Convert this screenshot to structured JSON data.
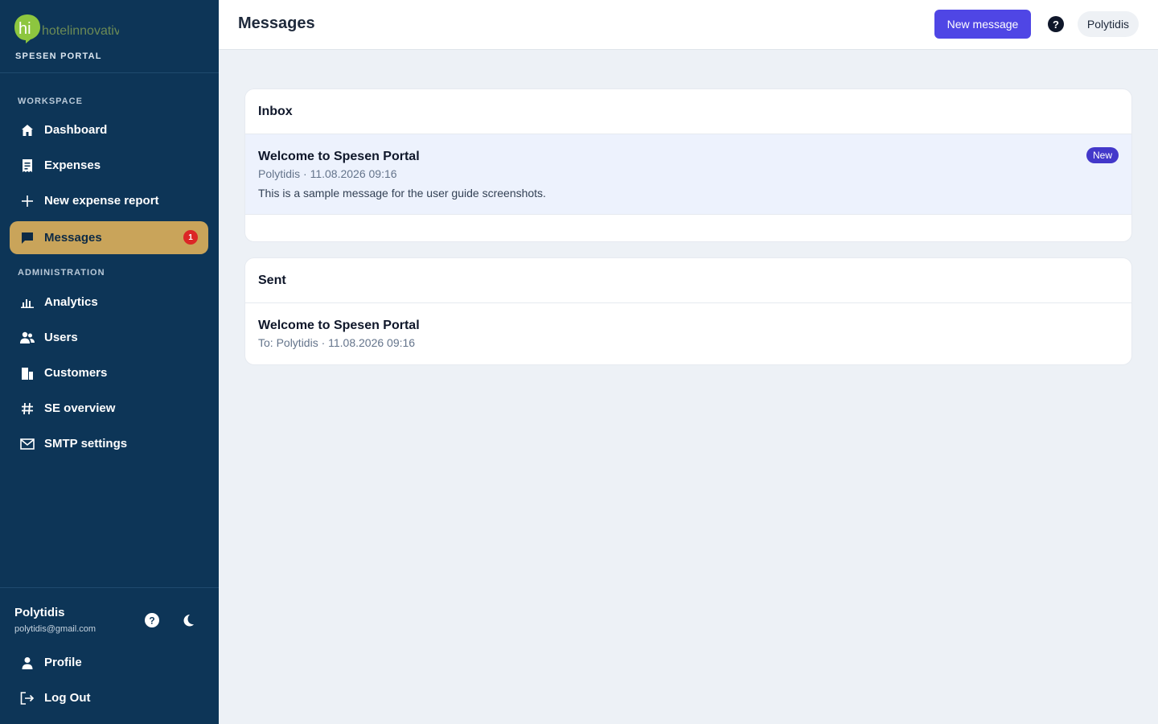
{
  "brand": {
    "logo_mark": "hi",
    "logo_text": "hotelinnovativ",
    "portal_name": "SPESEN PORTAL"
  },
  "sidebar": {
    "workspace_label": "WORKSPACE",
    "administration_label": "ADMINISTRATION",
    "workspace_items": [
      {
        "label": "Dashboard",
        "icon": "home-icon"
      },
      {
        "label": "Expenses",
        "icon": "receipt-icon"
      },
      {
        "label": "New expense report",
        "icon": "plus-icon"
      },
      {
        "label": "Messages",
        "icon": "chat-icon",
        "active": true,
        "badge": "1"
      }
    ],
    "admin_items": [
      {
        "label": "Analytics",
        "icon": "bar-chart-icon"
      },
      {
        "label": "Users",
        "icon": "users-icon"
      },
      {
        "label": "Customers",
        "icon": "building-icon"
      },
      {
        "label": "SE overview",
        "icon": "hash-icon"
      },
      {
        "label": "SMTP settings",
        "icon": "mail-icon"
      }
    ],
    "footer": {
      "user_name": "Polytidis",
      "user_email": "polytidis@gmail.com",
      "profile_label": "Profile",
      "logout_label": "Log Out"
    }
  },
  "header": {
    "title": "Messages",
    "new_message_label": "New message",
    "user_chip": "Polytidis"
  },
  "inbox": {
    "title": "Inbox",
    "messages": [
      {
        "subject": "Welcome to Spesen Portal",
        "meta": "Polytidis · 11.08.2026 09:16",
        "body": "This is a sample message for the user guide screenshots.",
        "badge": "New"
      }
    ]
  },
  "sent": {
    "title": "Sent",
    "messages": [
      {
        "subject": "Welcome to Spesen Portal",
        "meta": "To: Polytidis · 11.08.2026 09:16"
      }
    ]
  },
  "colors": {
    "sidebar_bg": "#0d3557",
    "active_nav": "#c9a45a",
    "primary": "#4f46e5",
    "badge_red": "#dc2626",
    "logo_green": "#8dc63f"
  }
}
